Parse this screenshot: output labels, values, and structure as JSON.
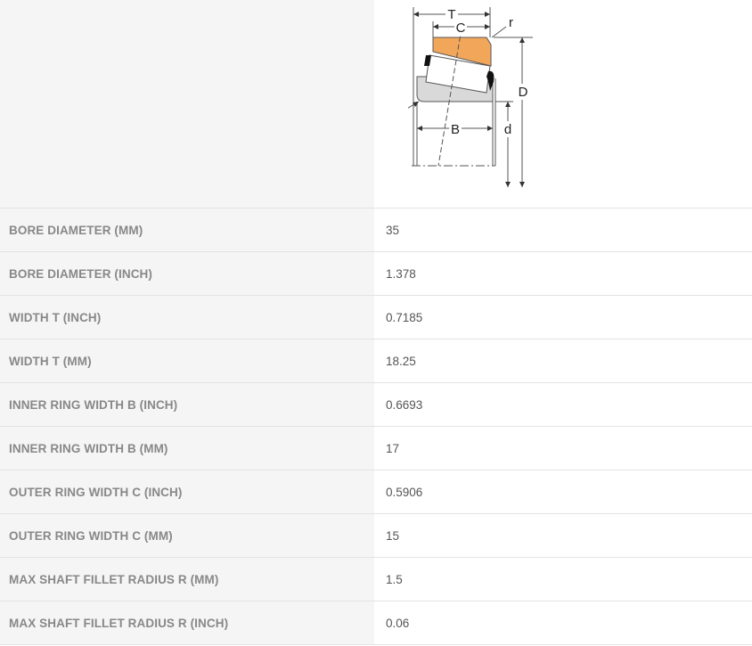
{
  "diagram": {
    "labels": {
      "T": "T",
      "C": "C",
      "r": "r",
      "D": "D",
      "R": "R",
      "B": "B",
      "d": "d"
    },
    "colors": {
      "cup": "#f2a65a",
      "cone": "#d9d9d9",
      "roller": "#ffffff",
      "line": "#333333"
    }
  },
  "specs": [
    {
      "label": "BORE DIAMETER (MM)",
      "value": "35"
    },
    {
      "label": "BORE DIAMETER (INCH)",
      "value": "1.378"
    },
    {
      "label": "WIDTH T (INCH)",
      "value": "0.7185"
    },
    {
      "label": "WIDTH T (MM)",
      "value": "18.25"
    },
    {
      "label": "INNER RING WIDTH B (INCH)",
      "value": "0.6693"
    },
    {
      "label": "INNER RING WIDTH B (MM)",
      "value": "17"
    },
    {
      "label": "OUTER RING WIDTH C (INCH)",
      "value": "0.5906"
    },
    {
      "label": "OUTER RING WIDTH C (MM)",
      "value": "15"
    },
    {
      "label": "MAX SHAFT FILLET RADIUS R (MM)",
      "value": "1.5"
    },
    {
      "label": "MAX SHAFT FILLET RADIUS R (INCH)",
      "value": "0.06"
    }
  ]
}
